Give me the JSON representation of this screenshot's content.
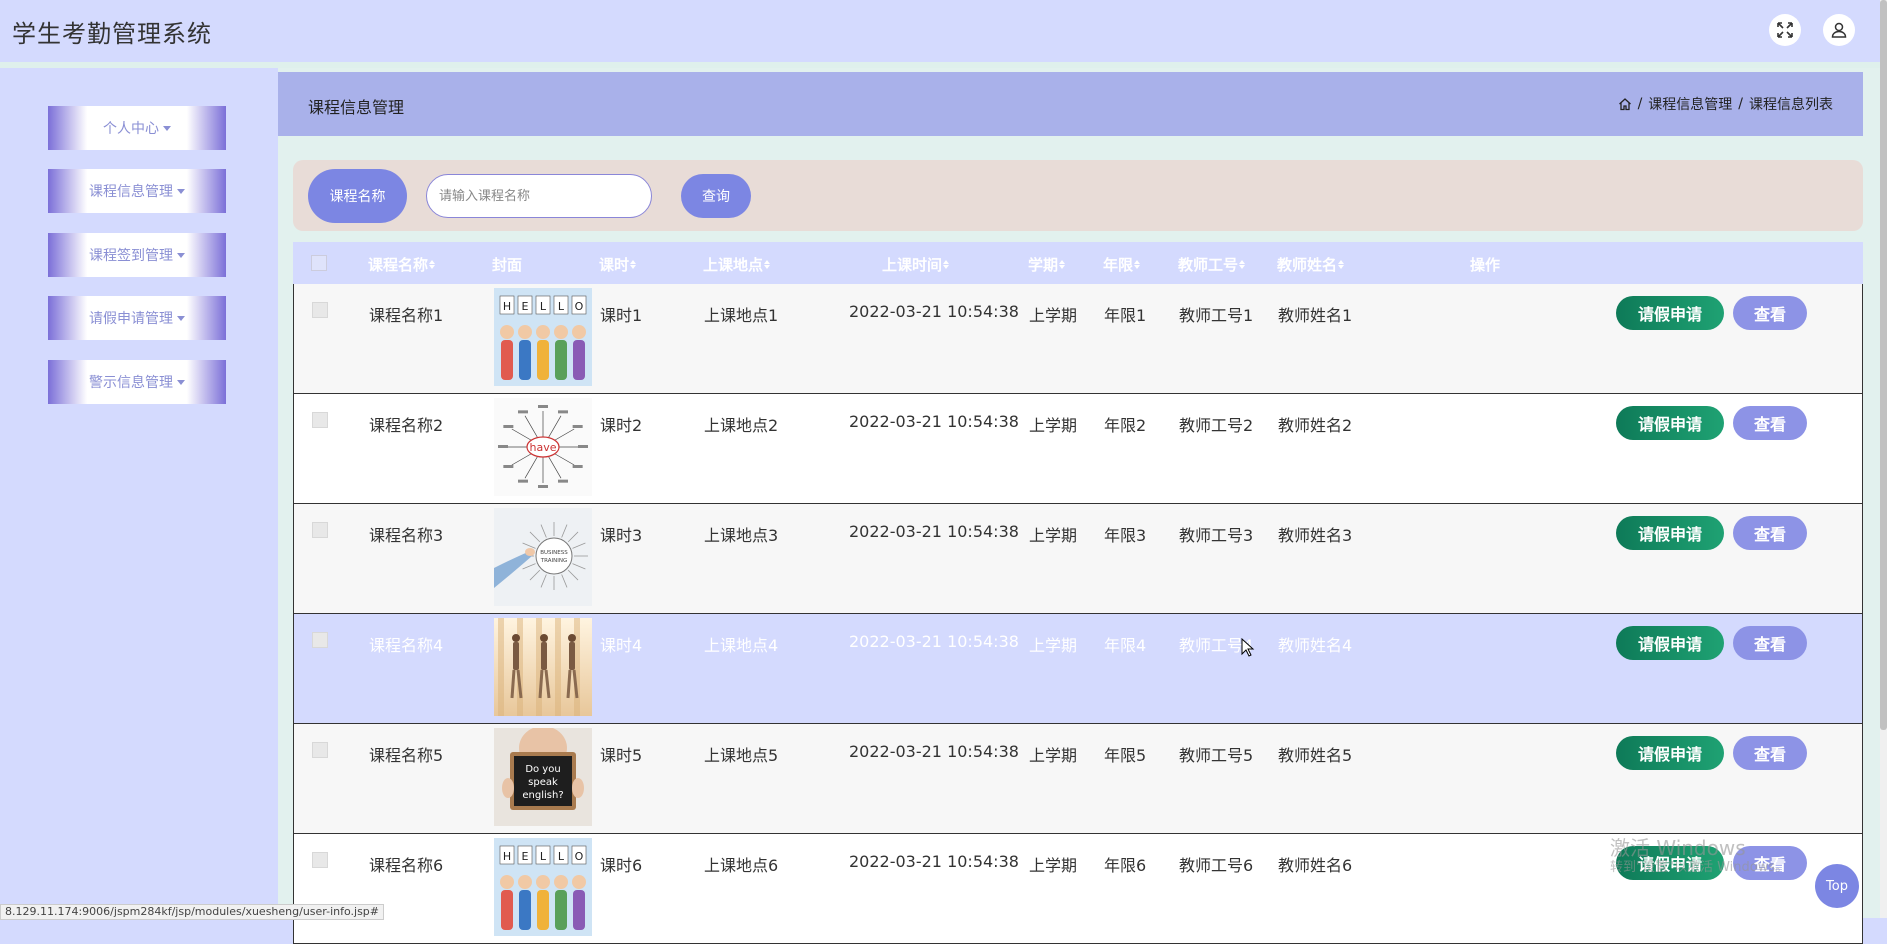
{
  "app": {
    "title": "学生考勤管理系统"
  },
  "sidebar": {
    "items": [
      {
        "label": "个人中心"
      },
      {
        "label": "课程信息管理"
      },
      {
        "label": "课程签到管理"
      },
      {
        "label": "请假申请管理"
      },
      {
        "label": "警示信息管理"
      }
    ]
  },
  "header": {
    "title": "课程信息管理",
    "breadcrumb": [
      "课程信息管理",
      "课程信息列表"
    ],
    "separator": "/"
  },
  "search": {
    "label": "课程名称",
    "placeholder": "请输入课程名称",
    "button": "查询"
  },
  "table": {
    "columns": [
      "课程名称",
      "封面",
      "课时",
      "上课地点",
      "上课时间",
      "学期",
      "年限",
      "教师工号",
      "教师姓名",
      "操作"
    ],
    "rows": [
      {
        "name": "课程名称1",
        "cover": "hello-kids",
        "hours": "课时1",
        "place": "上课地点1",
        "time": "2022-03-21 10:54:38",
        "term": "上学期",
        "years": "年限1",
        "teacher_id": "教师工号1",
        "teacher_name": "教师姓名1"
      },
      {
        "name": "课程名称2",
        "cover": "have-mindmap",
        "hours": "课时2",
        "place": "上课地点2",
        "time": "2022-03-21 10:54:38",
        "term": "上学期",
        "years": "年限2",
        "teacher_id": "教师工号2",
        "teacher_name": "教师姓名2"
      },
      {
        "name": "课程名称3",
        "cover": "business-training",
        "hours": "课时3",
        "place": "上课地点3",
        "time": "2022-03-21 10:54:38",
        "term": "上学期",
        "years": "年限3",
        "teacher_id": "教师工号3",
        "teacher_name": "教师姓名3"
      },
      {
        "name": "课程名称4",
        "cover": "dancers",
        "hours": "课时4",
        "place": "上课地点4",
        "time": "2022-03-21 10:54:38",
        "term": "上学期",
        "years": "年限4",
        "teacher_id": "教师工号4",
        "teacher_name": "教师姓名4"
      },
      {
        "name": "课程名称5",
        "cover": "speak-english-sign",
        "hours": "课时5",
        "place": "上课地点5",
        "time": "2022-03-21 10:54:38",
        "term": "上学期",
        "years": "年限5",
        "teacher_id": "教师工号5",
        "teacher_name": "教师姓名5"
      },
      {
        "name": "课程名称6",
        "cover": "hello-kids",
        "hours": "课时6",
        "place": "上课地点6",
        "time": "2022-03-21 10:54:38",
        "term": "上学期",
        "years": "年限6",
        "teacher_id": "教师工号6",
        "teacher_name": "教师姓名6"
      }
    ],
    "actions": {
      "leave": "请假申请",
      "view": "查看"
    },
    "highlighted_row": 3
  },
  "cover_text": {
    "hello": [
      "H",
      "E",
      "L",
      "L",
      "O"
    ],
    "have": "have",
    "business": [
      "BUSINESS",
      "TRAINING"
    ],
    "english": [
      "Do you",
      "speak",
      "english?"
    ]
  },
  "watermark": {
    "line1": "激活 Windows",
    "line2": "转到\"设置\"以激活 Windows。"
  },
  "top_button": "Top",
  "status_url": "8.129.11.174:9006/jspm284kf/jsp/modules/xuesheng/user-info.jsp#",
  "colors": {
    "accent": "#7c86e3",
    "leave_button": "#1a8f66",
    "header_bar": "#a9b1ea",
    "background": "#d4dafe"
  }
}
